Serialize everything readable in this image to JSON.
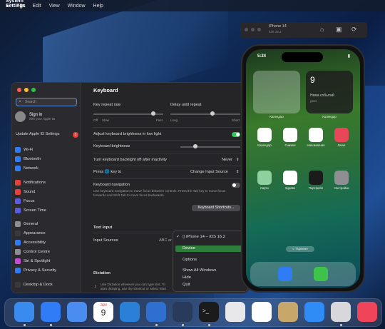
{
  "menubar": {
    "app": "System Settings",
    "items": [
      "File",
      "Edit",
      "View",
      "Window",
      "Help"
    ]
  },
  "sidebar": {
    "search_placeholder": "Search",
    "account_name": "Sign in",
    "account_sub": "with your Apple ID",
    "update_label": "Update Apple ID Settings",
    "update_badge": "1",
    "items": [
      {
        "label": "Wi-Fi",
        "color": "#2f7cf6"
      },
      {
        "label": "Bluetooth",
        "color": "#2f7cf6"
      },
      {
        "label": "Network",
        "color": "#2f7cf6"
      },
      {
        "label": "Notifications",
        "color": "#e5413b"
      },
      {
        "label": "Sound",
        "color": "#e5413b"
      },
      {
        "label": "Focus",
        "color": "#5b5ce2"
      },
      {
        "label": "Screen Time",
        "color": "#5b5ce2"
      },
      {
        "label": "General",
        "color": "#8e8e93"
      },
      {
        "label": "Appearance",
        "color": "#3a3a3c"
      },
      {
        "label": "Accessibility",
        "color": "#2f7cf6"
      },
      {
        "label": "Control Centre",
        "color": "#8e8e93"
      },
      {
        "label": "Siri & Spotlight",
        "color": "#c74ad6"
      },
      {
        "label": "Privacy & Security",
        "color": "#2f7cf6"
      },
      {
        "label": "Desktop & Dock",
        "color": "#3a3a3c"
      }
    ]
  },
  "keyboard": {
    "title": "Keyboard",
    "key_repeat": "Key repeat rate",
    "delay": "Delay until repeat",
    "off": "Off",
    "slow": "Slow",
    "fast": "Fast",
    "long": "Long",
    "short": "Short",
    "adjust_brightness": "Adjust keyboard brightness in low light",
    "brightness": "Keyboard brightness",
    "backlight_off": "Turn keyboard backlight off after inactivity",
    "backlight_value": "Never",
    "press_key": "Press 🌐 key to",
    "press_key_value": "Change Input Source",
    "nav_title": "Keyboard navigation",
    "nav_desc": "Use keyboard navigation to move focus between controls. Press the Tab key to move focus forwards and Shift Tab to move focus backwards.",
    "shortcuts_button": "Keyboard Shortcuts...",
    "text_input": "Text Input",
    "input_sources": "Input Sources",
    "input_value": "ABC ar",
    "dictation": "Dictation",
    "dictation_desc": "Use Dictation wherever you can type text. To start dictating, use the shortcut or select Start Dictation from the Edit menu."
  },
  "context_menu": {
    "items": [
      "iPhone 14 – iOS 16.2",
      "Device",
      "Options",
      "Show All Windows",
      "Hide",
      "Quit"
    ]
  },
  "simulator": {
    "device": "iPhone 14",
    "os": "iOS 16.2",
    "time": "5:24",
    "widget_date": "9",
    "widget_text": "Нема событий",
    "widget_sub": "днес",
    "widget_label_left": "Календар",
    "widget_label_right": "Календар",
    "search_label": "Търсене",
    "apps": [
      {
        "label": "Календар",
        "color": "#ffffff"
      },
      {
        "label": "Снимки",
        "color": "#ffffff"
      },
      {
        "label": "Напомняния",
        "color": "#ffffff"
      },
      {
        "label": "News",
        "color": "#e8475a"
      },
      {
        "label": "Карти",
        "color": "#8fd19e"
      },
      {
        "label": "Здраве",
        "color": "#ffffff"
      },
      {
        "label": "Портфейл",
        "color": "#1b1b1b"
      },
      {
        "label": "Настройки",
        "color": "#8e8e93"
      }
    ],
    "dock_apps": [
      {
        "name": "safari",
        "color": "#2f7cf6"
      },
      {
        "name": "messages",
        "color": "#3ec24a"
      }
    ]
  },
  "dock": {
    "apps": [
      {
        "name": "finder",
        "color": "#3a8bef"
      },
      {
        "name": "safari",
        "color": "#2f7cf6"
      },
      {
        "name": "mail",
        "color": "#4a8cf0"
      },
      {
        "name": "calendar",
        "color": "#ffffff",
        "month": "JAN",
        "day": "9"
      },
      {
        "name": "vscode",
        "color": "#2a7fd6"
      },
      {
        "name": "xcode",
        "color": "#2f6fd0"
      },
      {
        "name": "simulator",
        "color": "#2a3a5a"
      },
      {
        "name": "terminal",
        "color": "#1b1b1b"
      },
      {
        "name": "instruments",
        "color": "#e8e8ea"
      },
      {
        "name": "freeform",
        "color": "#ffffff"
      },
      {
        "name": "utilities",
        "color": "#c8a86a"
      },
      {
        "name": "app-store",
        "color": "#2f8cf6"
      },
      {
        "name": "preview",
        "color": "#d8d8dc"
      },
      {
        "name": "music",
        "color": "#f0445a"
      }
    ]
  }
}
